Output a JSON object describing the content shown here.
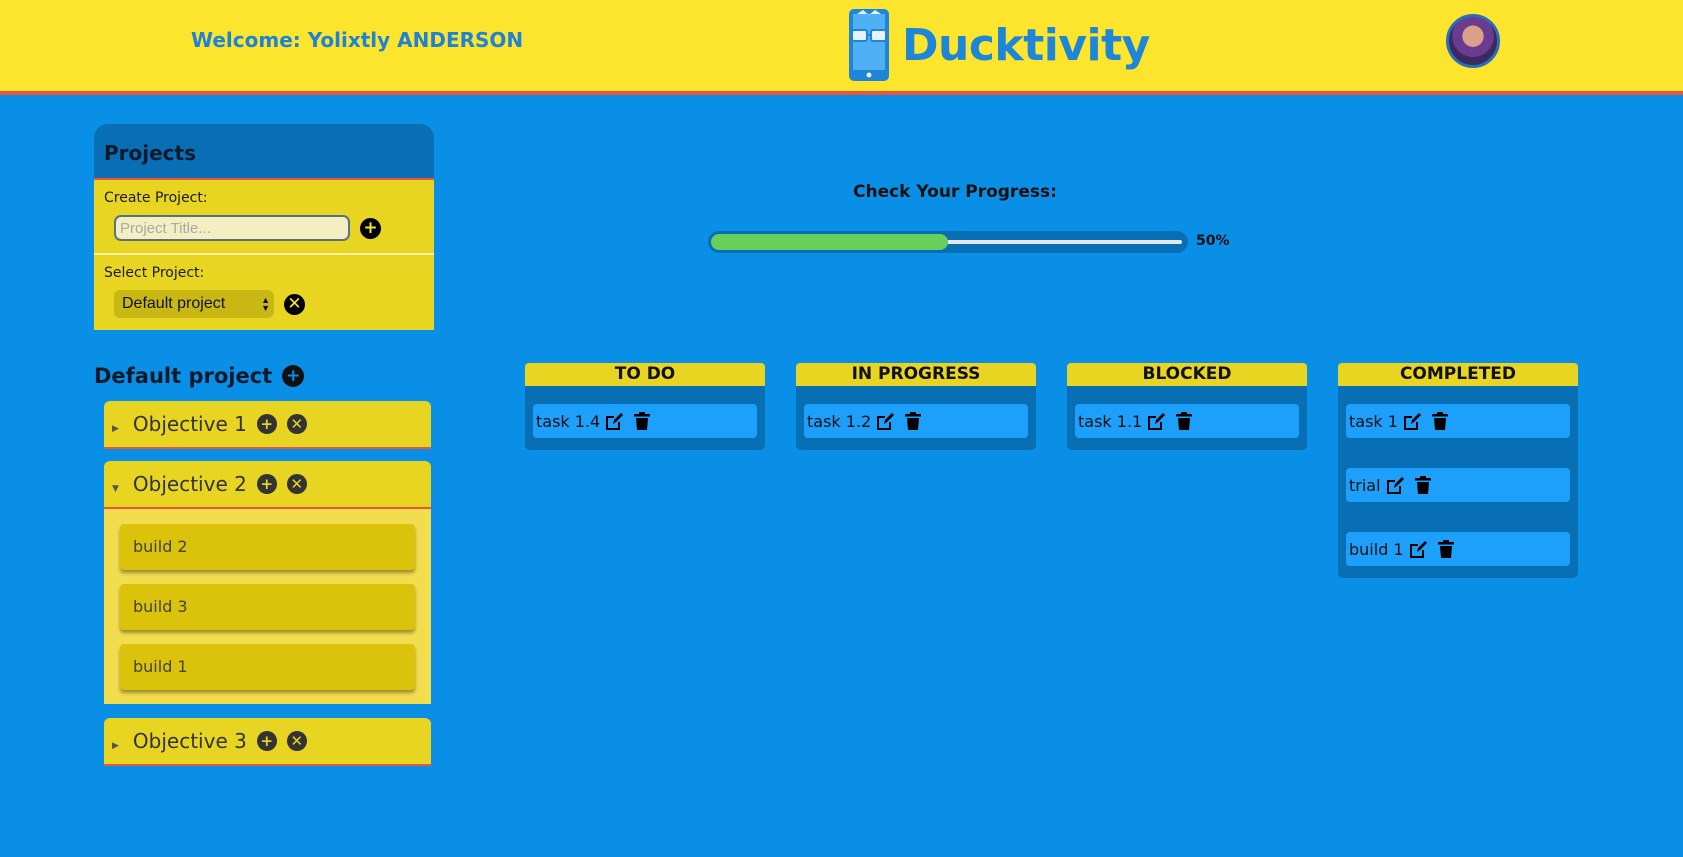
{
  "header": {
    "welcome": "Welcome: Yolixtly ANDERSON",
    "app_name": "Ducktivity"
  },
  "projects": {
    "title": "Projects",
    "create_label": "Create Project:",
    "create_placeholder": "Project Title...",
    "select_label": "Select Project:",
    "selected_project": "Default project"
  },
  "current_project": {
    "name": "Default project",
    "objectives": [
      {
        "label": "Objective 1",
        "expanded": false,
        "builds": []
      },
      {
        "label": "Objective 2",
        "expanded": true,
        "builds": [
          "build 2",
          "build 3",
          "build 1"
        ]
      },
      {
        "label": "Objective 3",
        "expanded": false,
        "builds": []
      }
    ]
  },
  "progress": {
    "label": "Check Your Progress:",
    "percent_text": "50%",
    "value": 0.5
  },
  "board": {
    "columns": [
      {
        "title": "TO DO",
        "tasks": [
          "task 1.4"
        ]
      },
      {
        "title": "IN PROGRESS",
        "tasks": [
          "task 1.2"
        ]
      },
      {
        "title": "BLOCKED",
        "tasks": [
          "task 1.1"
        ]
      },
      {
        "title": "COMPLETED",
        "tasks": [
          "task 1",
          "trial",
          "build 1"
        ]
      }
    ]
  },
  "icons": {
    "add": "plus-circle-icon",
    "remove": "x-circle-icon",
    "edit": "edit-icon",
    "delete": "trash-icon"
  },
  "colors": {
    "header_bg": "#fde52d",
    "page_bg": "#0a8fe6",
    "panel_dark": "#086fb5",
    "accent_red": "#e8573d",
    "progress_green": "#69cf5c",
    "task_bg": "#1da0fb"
  }
}
